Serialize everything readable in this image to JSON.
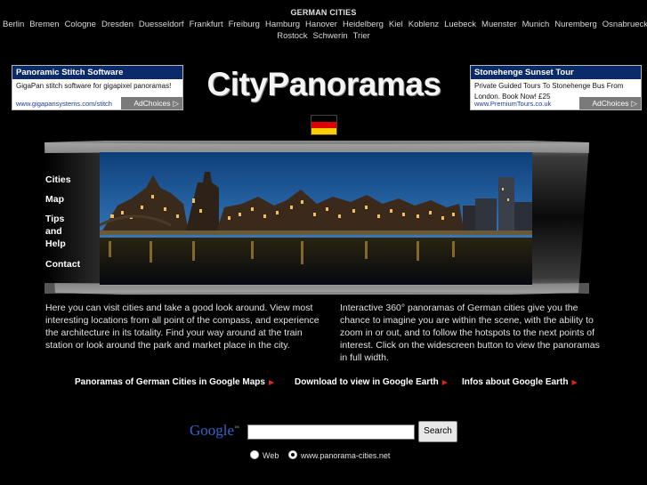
{
  "nav": {
    "title": "GERMAN CITIES",
    "cities": [
      "Berlin",
      "Bremen",
      "Cologne",
      "Dresden",
      "Duesseldorf",
      "Frankfurt",
      "Freiburg",
      "Hamburg",
      "Hanover",
      "Heidelberg",
      "Kiel",
      "Koblenz",
      "Luebeck",
      "Muenster",
      "Munich",
      "Nuremberg",
      "Osnabrueck",
      "Rostock",
      "Schwerin",
      "Trier"
    ]
  },
  "ads": {
    "left": {
      "title": "Panoramic Stitch Software",
      "body": "GigaPan stitch software for gigapixel panoramas!",
      "url": "www.gigapansystems.com/stitch",
      "adchoices": "AdChoices"
    },
    "right": {
      "title": "Stonehenge Sunset Tour",
      "body": "Private Guided Tours To Stonehenge Bus From London. Book Now! £25",
      "url": "www.PremiumTours.co.uk",
      "adchoices": "AdChoices"
    }
  },
  "logo": "CityPanoramas",
  "flag": {
    "black": "#000000",
    "red": "#DD0000",
    "gold": "#FFCE00"
  },
  "sidenav": [
    "Cities",
    "Map",
    "Tips and Help",
    "Contact"
  ],
  "intro": {
    "left": "Here you can visit cities and take a good look around. View most interesting locations from all point of the compass, and experience the architecture in its totality. Find your way around at the train station or look around the park and market place in the city.",
    "right": "Interactive 360° panoramas of German cities give you the chance to imagine you are within the scene, with the ability to zoom in or out, and to follow the hotspots to the next points of interest. Click on the widescreen button to view the panoramas in full width."
  },
  "links": [
    "Panoramas of German Cities in Google Maps",
    "Download to view in Google Earth",
    "Infos about Google Earth"
  ],
  "search": {
    "logo": "Google",
    "button": "Search",
    "input_value": "",
    "options": [
      "Web",
      "www.panorama-cities.net"
    ],
    "selected_option": "www.panorama-cities.net"
  },
  "colors": {
    "background": "#000000",
    "link_arrow": "#D32A18",
    "ad_title_bg": "#0A2A6A"
  }
}
